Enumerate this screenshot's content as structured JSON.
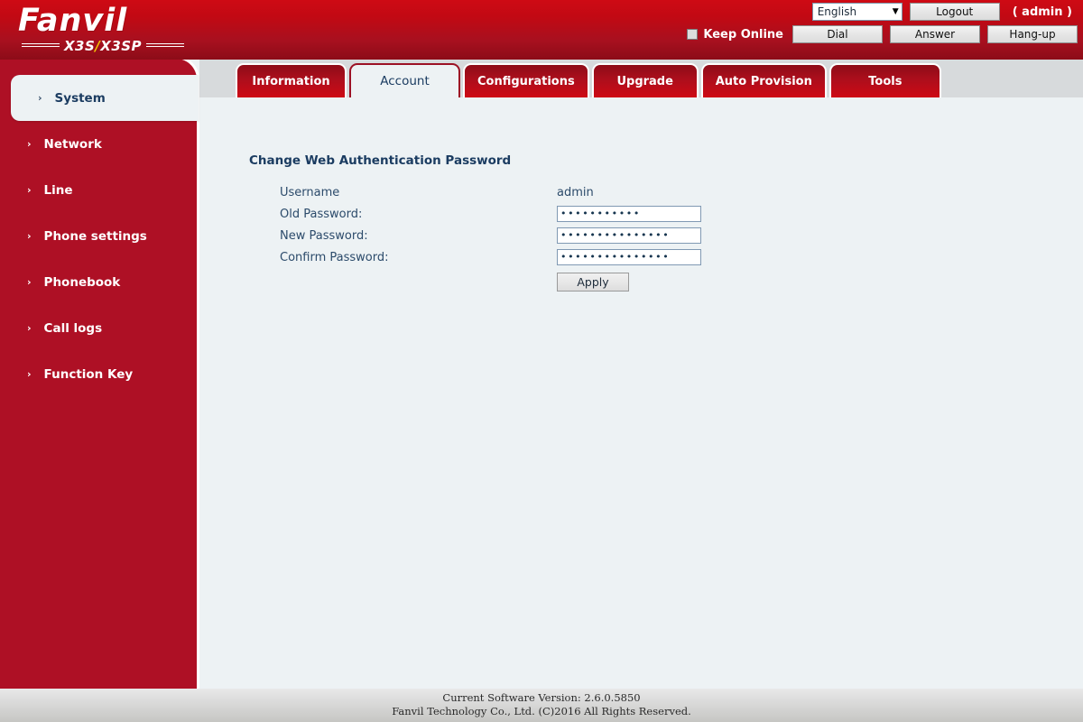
{
  "brand": {
    "logo_text": "Fanvil",
    "model_left": "X3S",
    "model_slash": "/",
    "model_right": "X3SP"
  },
  "header": {
    "language_value": "English",
    "language_caret": "chevron-down-icon",
    "logout_label": "Logout",
    "admin_label": "( admin )",
    "keep_online_label": "Keep Online",
    "dial_label": "Dial",
    "answer_label": "Answer",
    "hangup_label": "Hang-up"
  },
  "tabs": [
    {
      "label": "Information",
      "active": false
    },
    {
      "label": "Account",
      "active": true
    },
    {
      "label": "Configurations",
      "active": false
    },
    {
      "label": "Upgrade",
      "active": false
    },
    {
      "label": "Auto Provision",
      "active": false
    },
    {
      "label": "Tools",
      "active": false
    }
  ],
  "sidebar": {
    "items": [
      {
        "label": "System",
        "active": true
      },
      {
        "label": "Network",
        "active": false
      },
      {
        "label": "Line",
        "active": false
      },
      {
        "label": "Phone settings",
        "active": false
      },
      {
        "label": "Phonebook",
        "active": false
      },
      {
        "label": "Call logs",
        "active": false
      },
      {
        "label": "Function Key",
        "active": false
      }
    ],
    "chevron": "›"
  },
  "main": {
    "panel_title": "Change Web Authentication Password",
    "fields": {
      "username_label": "Username",
      "username_value": "admin",
      "old_password_label": "Old Password:",
      "old_password_value": "•••••••••••",
      "new_password_label": "New Password:",
      "new_password_value": "•••••••••••••••",
      "confirm_password_label": "Confirm Password:",
      "confirm_password_value": "•••••••••••••••"
    },
    "apply_label": "Apply"
  },
  "footer": {
    "line1": "Current Software Version: 2.6.0.5850",
    "line2": "Fanvil Technology Co., Ltd. (C)2016 All Rights Reserved."
  },
  "colors": {
    "brand_red": "#AE1025",
    "header_red_top": "#CE0A14",
    "header_red_bottom": "#8C0C18",
    "content_bg": "#EDF2F4",
    "tabbar_bg": "#D7DADC",
    "text_navy": "#1B3C61"
  }
}
